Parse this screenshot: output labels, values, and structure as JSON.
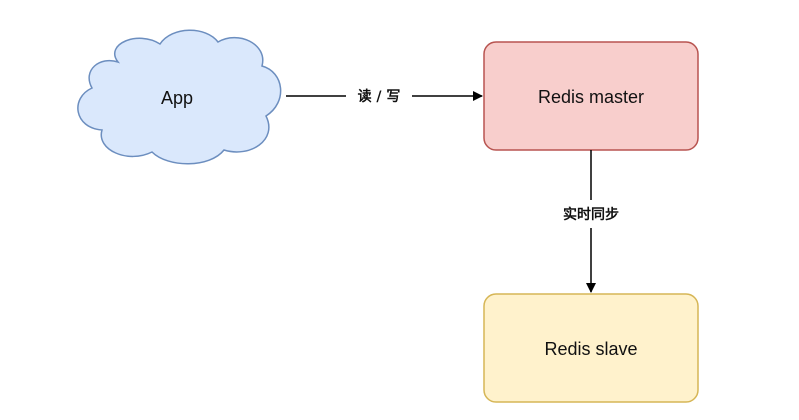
{
  "nodes": {
    "app": {
      "label": "App",
      "shape": "cloud",
      "fill": "#dae8fc",
      "stroke": "#6c8ebf"
    },
    "master": {
      "label": "Redis master",
      "shape": "rounded-rect",
      "fill": "#f8cecc",
      "stroke": "#b85450"
    },
    "slave": {
      "label": "Redis slave",
      "shape": "rounded-rect",
      "fill": "#fff2cc",
      "stroke": "#d6b656"
    }
  },
  "edges": {
    "app_to_master": {
      "label": "读 / 写"
    },
    "master_to_slave": {
      "label": "实时同步"
    }
  },
  "colors": {
    "edge": "#000000",
    "background": "#ffffff"
  }
}
